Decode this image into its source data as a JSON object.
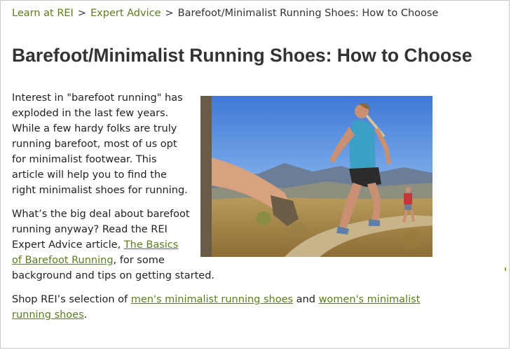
{
  "breadcrumb": {
    "items": [
      {
        "label": "Learn at REI"
      },
      {
        "label": "Expert Advice"
      }
    ],
    "separator": ">",
    "current": "Barefoot/Minimalist Running Shoes: How to Choose"
  },
  "page_title": "Barefoot/Minimalist Running Shoes: How to Choose",
  "intro_paragraph": "Interest in \"barefoot running\" has exploded in the last few years. While a few hardy folks are truly running barefoot, most of us opt for minimalist footwear. This article will help you to find the right minimalist shoes for running.",
  "paragraph2": {
    "text_before": "What’s the big deal about barefoot running anyway? Read the REI Expert Advice article, ",
    "link": "The Basics of Barefoot Running",
    "text_after": ", for some background and tips on getting started."
  },
  "paragraph3": {
    "text_before": "Shop REI’s selection of ",
    "link1": "men's minimalist running shoes",
    "text_middle": " and ",
    "link2": "women's minimalist running shoes",
    "text_after": "."
  },
  "colors": {
    "link": "#5a7d1e",
    "title": "#333333"
  }
}
